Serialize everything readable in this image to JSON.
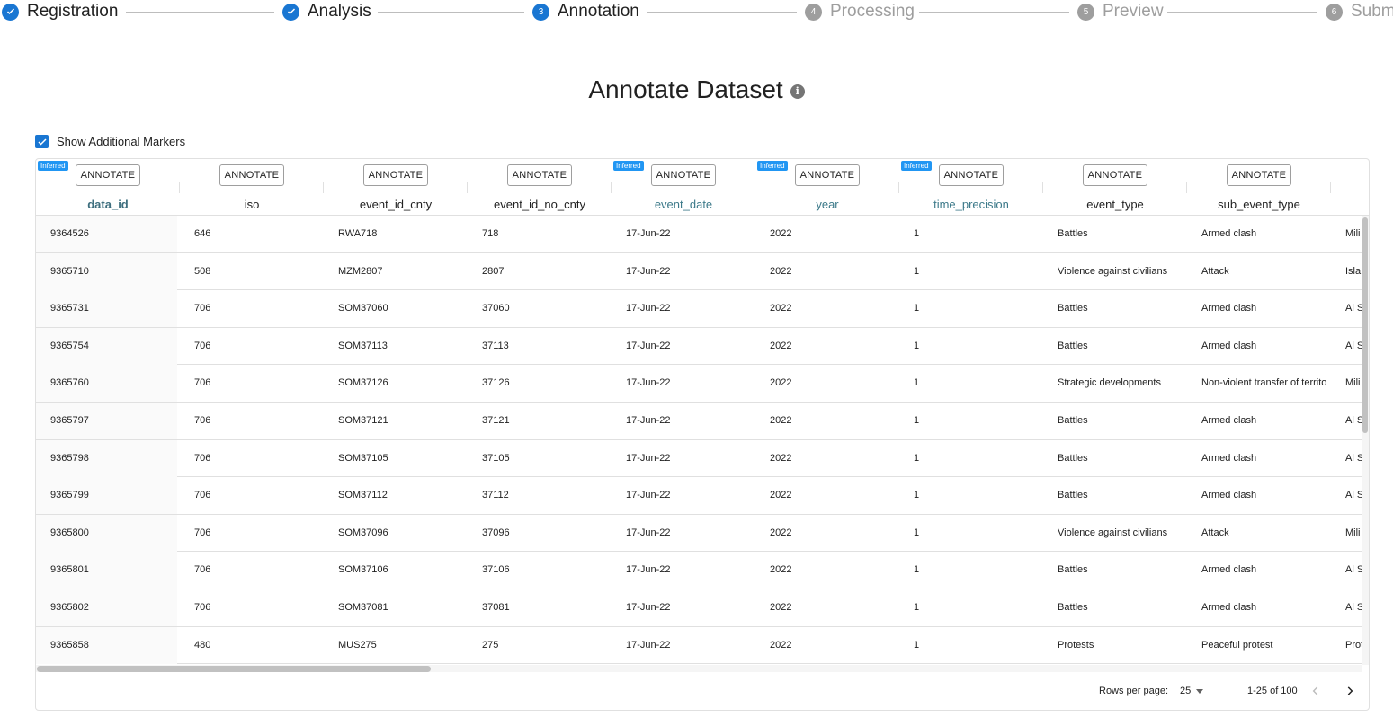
{
  "stepper": {
    "steps": [
      {
        "label": "Registration",
        "state": "done",
        "num": ""
      },
      {
        "label": "Analysis",
        "state": "done",
        "num": ""
      },
      {
        "label": "Annotation",
        "state": "active",
        "num": "3"
      },
      {
        "label": "Processing",
        "state": "pending",
        "num": "4"
      },
      {
        "label": "Preview",
        "state": "pending",
        "num": "5"
      },
      {
        "label": "Subm",
        "state": "pending",
        "num": "6"
      }
    ]
  },
  "title": "Annotate Dataset",
  "info_glyph": "i",
  "markers": {
    "label": "Show Additional Markers",
    "checked": true
  },
  "annotate_label": "ANNOTATE",
  "inferred_label": "Inferred",
  "columns": [
    {
      "name": "data_id",
      "inferred": true
    },
    {
      "name": "iso",
      "inferred": false
    },
    {
      "name": "event_id_cnty",
      "inferred": false
    },
    {
      "name": "event_id_no_cnty",
      "inferred": false
    },
    {
      "name": "event_date",
      "inferred": true
    },
    {
      "name": "year",
      "inferred": true
    },
    {
      "name": "time_precision",
      "inferred": true
    },
    {
      "name": "event_type",
      "inferred": false
    },
    {
      "name": "sub_event_type",
      "inferred": false
    },
    {
      "name": "",
      "inferred": false
    }
  ],
  "rows": [
    [
      "9364526",
      "646",
      "RWA718",
      "718",
      "17-Jun-22",
      "2022",
      "1",
      "Battles",
      "Armed clash",
      "Mili"
    ],
    [
      "9365710",
      "508",
      "MZM2807",
      "2807",
      "17-Jun-22",
      "2022",
      "1",
      "Violence against civilians",
      "Attack",
      "Isla"
    ],
    [
      "9365731",
      "706",
      "SOM37060",
      "37060",
      "17-Jun-22",
      "2022",
      "1",
      "Battles",
      "Armed clash",
      "Al S"
    ],
    [
      "9365754",
      "706",
      "SOM37113",
      "37113",
      "17-Jun-22",
      "2022",
      "1",
      "Battles",
      "Armed clash",
      "Al S"
    ],
    [
      "9365760",
      "706",
      "SOM37126",
      "37126",
      "17-Jun-22",
      "2022",
      "1",
      "Strategic developments",
      "Non-violent transfer of territo",
      "Mili"
    ],
    [
      "9365797",
      "706",
      "SOM37121",
      "37121",
      "17-Jun-22",
      "2022",
      "1",
      "Battles",
      "Armed clash",
      "Al S"
    ],
    [
      "9365798",
      "706",
      "SOM37105",
      "37105",
      "17-Jun-22",
      "2022",
      "1",
      "Battles",
      "Armed clash",
      "Al S"
    ],
    [
      "9365799",
      "706",
      "SOM37112",
      "37112",
      "17-Jun-22",
      "2022",
      "1",
      "Battles",
      "Armed clash",
      "Al S"
    ],
    [
      "9365800",
      "706",
      "SOM37096",
      "37096",
      "17-Jun-22",
      "2022",
      "1",
      "Violence against civilians",
      "Attack",
      "Mili"
    ],
    [
      "9365801",
      "706",
      "SOM37106",
      "37106",
      "17-Jun-22",
      "2022",
      "1",
      "Battles",
      "Armed clash",
      "Al S"
    ],
    [
      "9365802",
      "706",
      "SOM37081",
      "37081",
      "17-Jun-22",
      "2022",
      "1",
      "Battles",
      "Armed clash",
      "Al S"
    ],
    [
      "9365858",
      "480",
      "MUS275",
      "275",
      "17-Jun-22",
      "2022",
      "1",
      "Protests",
      "Peaceful protest",
      "Prot"
    ]
  ],
  "pagination": {
    "rows_per_page_label": "Rows per page:",
    "rows_per_page_value": "25",
    "range": "1-25 of 100"
  },
  "colors": {
    "accent": "#1976d2",
    "inferred_badge": "#2196f3",
    "pending": "#9e9e9e"
  }
}
